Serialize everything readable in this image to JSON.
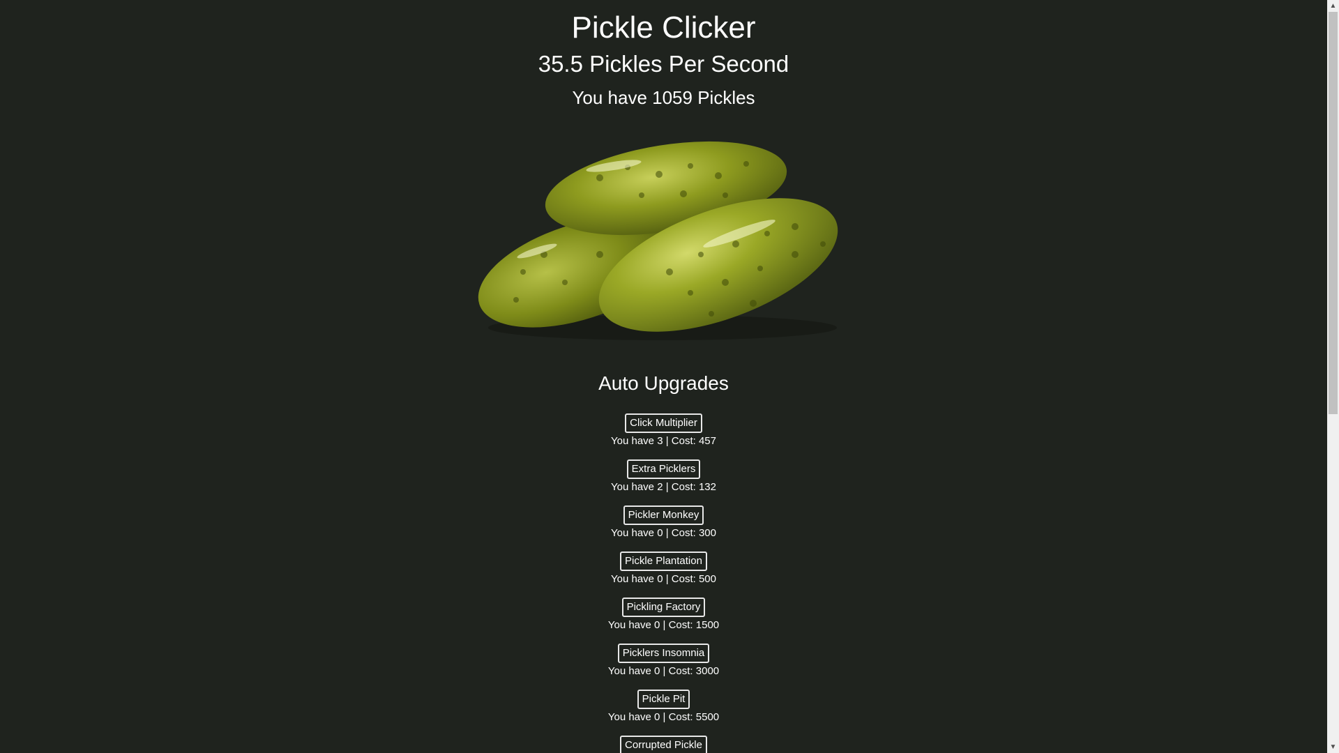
{
  "header": {
    "title": "Pickle Clicker",
    "per_second": "35.5 Pickles Per Second",
    "count": "You have 1059 Pickles"
  },
  "pickle_icon": "pickle-image",
  "upgrades_section": {
    "title": "Auto Upgrades",
    "items": [
      {
        "label": "Click Multiplier",
        "info": "You have 3 | Cost: 457"
      },
      {
        "label": "Extra Picklers",
        "info": "You have 2 | Cost: 132"
      },
      {
        "label": "Pickler Monkey",
        "info": "You have 0 | Cost: 300"
      },
      {
        "label": "Pickle Plantation",
        "info": "You have 0 | Cost: 500"
      },
      {
        "label": "Pickling Factory",
        "info": "You have 0 | Cost: 1500"
      },
      {
        "label": "Picklers Insomnia",
        "info": "You have 0 | Cost: 3000"
      },
      {
        "label": "Pickle Pit",
        "info": "You have 0 | Cost: 5500"
      },
      {
        "label": "Corrupted Pickle",
        "info": ""
      }
    ]
  },
  "colors": {
    "background": "#1f231e",
    "text": "#ffffff",
    "pickle": "#8a9a1e"
  }
}
